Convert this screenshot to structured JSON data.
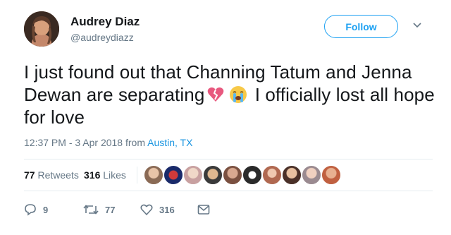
{
  "user": {
    "name": "Audrey Diaz",
    "handle": "@audreydiazz"
  },
  "follow_label": "Follow",
  "tweet": {
    "line_part1": "I just found out that Channing Tatum and Jenna Dewan are separating",
    "line_part2": "I officially lost all hope for love",
    "emojis": [
      "broken-heart-icon",
      "loudly-crying-face-icon"
    ]
  },
  "meta": {
    "time": "12:37 PM - 3 Apr 2018 from ",
    "location": "Austin, TX"
  },
  "stats": {
    "retweets_count": "77",
    "retweets_label": "Retweets",
    "likes_count": "316",
    "likes_label": "Likes"
  },
  "actions": {
    "replies": "9",
    "retweets": "77",
    "likes": "316"
  },
  "colors": {
    "accent": "#1da1f2",
    "muted": "#657786"
  }
}
